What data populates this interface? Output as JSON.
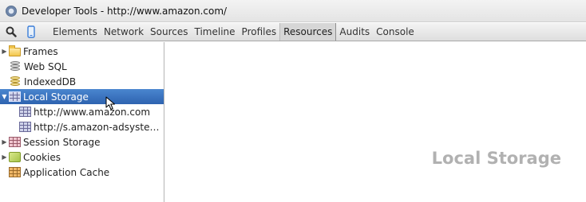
{
  "window": {
    "title": "Developer Tools - http://www.amazon.com/"
  },
  "toolbar": {
    "search_icon": "magnifier-icon",
    "device_icon": "mobile-device-icon",
    "tabs": [
      {
        "label": "Elements",
        "active": false
      },
      {
        "label": "Network",
        "active": false
      },
      {
        "label": "Sources",
        "active": false
      },
      {
        "label": "Timeline",
        "active": false
      },
      {
        "label": "Profiles",
        "active": false
      },
      {
        "label": "Resources",
        "active": true
      },
      {
        "label": "Audits",
        "active": false
      },
      {
        "label": "Console",
        "active": false
      }
    ]
  },
  "sidebar": {
    "items": [
      {
        "label": "Frames",
        "icon": "folder-icon",
        "expandable": true,
        "expanded": false
      },
      {
        "label": "Web SQL",
        "icon": "database-icon",
        "expandable": false
      },
      {
        "label": "IndexedDB",
        "icon": "database-icon",
        "expandable": false
      },
      {
        "label": "Local Storage",
        "icon": "storage-grid-icon",
        "expandable": true,
        "expanded": true,
        "selected": true
      },
      {
        "label": "http://www.amazon.com",
        "icon": "storage-grid-icon",
        "child": true
      },
      {
        "label": "http://s.amazon-adsyste…",
        "icon": "storage-grid-icon",
        "child": true
      },
      {
        "label": "Session Storage",
        "icon": "storage-grid-icon",
        "expandable": true,
        "expanded": false
      },
      {
        "label": "Cookies",
        "icon": "cookie-icon",
        "expandable": true,
        "expanded": false
      },
      {
        "label": "Application Cache",
        "icon": "app-cache-icon",
        "expandable": false
      }
    ]
  },
  "main": {
    "empty_title": "Local Storage"
  },
  "colors": {
    "selection": "#3a74c2",
    "placeholder_text": "#b1b1b1"
  }
}
